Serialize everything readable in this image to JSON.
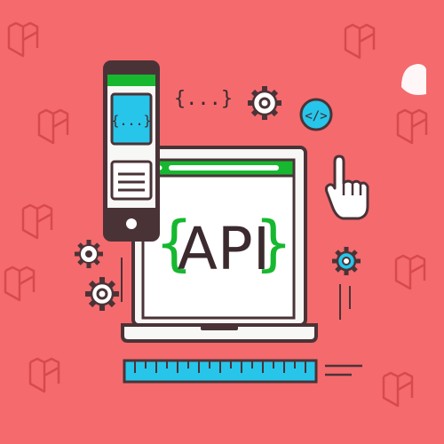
{
  "illustration": {
    "laptop_screen_text": "API",
    "left_brace": "{",
    "right_brace": "}",
    "phone_screen_text": "{...}",
    "floating_code_text": "{...}",
    "code_badge_text": "</>"
  },
  "icons": {
    "background_pattern": "laravel-logo-icon",
    "badge": "code-tag-icon",
    "gears": "gear-icon",
    "cursor": "pointing-hand-icon",
    "ruler": "ruler-icon"
  },
  "colors": {
    "background": "#f46a6d",
    "pattern": "#d8494e",
    "outline": "#4a3337",
    "screen": "#f7f7f5",
    "accent_green": "#17b82f",
    "accent_cyan": "#27c5ea",
    "white": "#ffffff"
  }
}
